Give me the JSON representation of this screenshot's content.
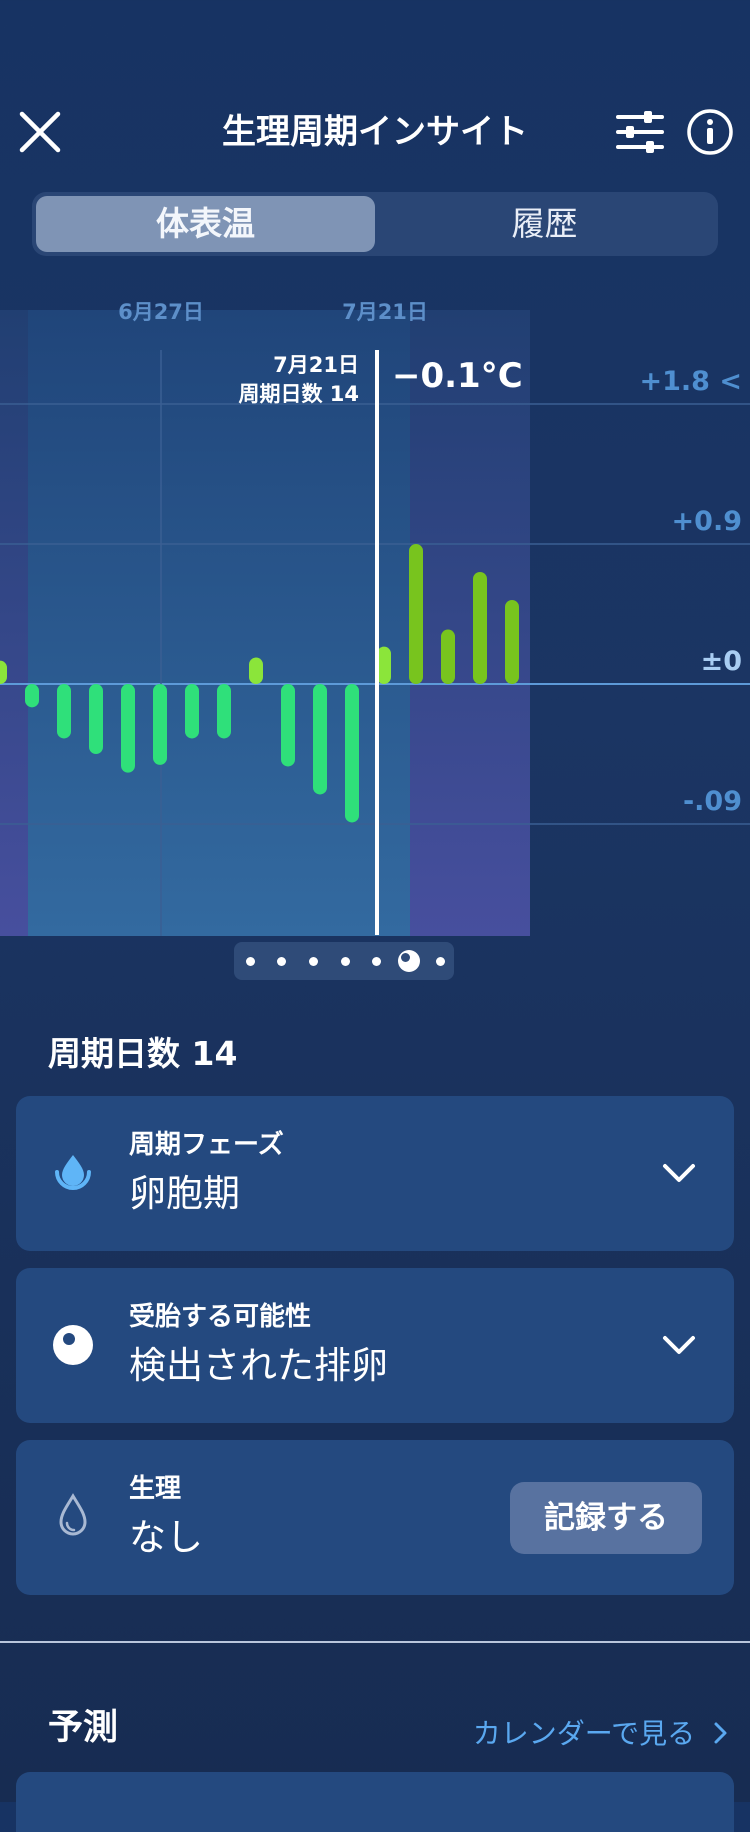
{
  "header": {
    "title": "生理周期インサイト"
  },
  "tabs": [
    {
      "label": "体表温",
      "active": true
    },
    {
      "label": "履歴",
      "active": false
    }
  ],
  "chart": {
    "date_labels": [
      "6月27日",
      "7月21日"
    ],
    "tooltip": {
      "date": "7月21日",
      "cycle_day": "周期日数 14",
      "temperature": "−0.1°C"
    },
    "y_labels": [
      "+1.8 <",
      "+0.9",
      "±0",
      "-.09"
    ]
  },
  "chart_data": {
    "type": "bar",
    "title": "",
    "xlabel": "",
    "ylabel": "",
    "y_tick_labels": [
      "+1.8 <",
      "+0.9",
      "±0",
      "-.09"
    ],
    "ylim": [
      -0.16,
      0.2
    ],
    "grid": true,
    "highlight_x": 12,
    "values": [
      0.015,
      -0.015,
      -0.035,
      -0.045,
      -0.057,
      -0.052,
      -0.035,
      -0.035,
      0.017,
      -0.053,
      -0.071,
      -0.089,
      0.024,
      0.09,
      0.035,
      0.072,
      0.054
    ]
  },
  "pager": {
    "count": 7,
    "active_index": 5
  },
  "cycle_day_heading": "周期日数 14",
  "cards": [
    {
      "label": "周期フェーズ",
      "value": "卵胞期"
    },
    {
      "label": "受胎する可能性",
      "value": "検出された排卵"
    },
    {
      "label": "生理",
      "value": "なし",
      "button": "記録する"
    }
  ],
  "forecast": {
    "title": "予測",
    "link": "カレンダーで見る"
  },
  "colors": {
    "bar_early": "#2fe07a",
    "bar_mid": "#8be53a",
    "bar_late": "#78c41e",
    "accent_link": "#5aa8f0"
  }
}
